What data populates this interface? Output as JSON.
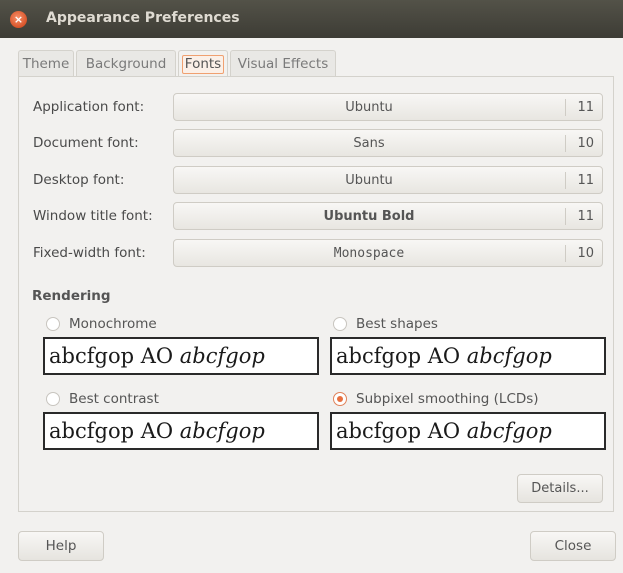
{
  "window": {
    "title": "Appearance Preferences"
  },
  "tabs": [
    {
      "label": "Theme"
    },
    {
      "label": "Background"
    },
    {
      "label": "Fonts"
    },
    {
      "label": "Visual Effects"
    }
  ],
  "active_tab": "Fonts",
  "fonts": [
    {
      "label": "Application font:",
      "name": "Ubuntu",
      "size": "11"
    },
    {
      "label": "Document font:",
      "name": "Sans",
      "size": "10"
    },
    {
      "label": "Desktop font:",
      "name": "Ubuntu",
      "size": "11"
    },
    {
      "label": "Window title font:",
      "name": "Ubuntu Bold",
      "size": "11"
    },
    {
      "label": "Fixed-width font:",
      "name": "Monospace",
      "size": "10"
    }
  ],
  "rendering": {
    "heading": "Rendering",
    "options": [
      {
        "label": "Monochrome",
        "selected": false
      },
      {
        "label": "Best shapes",
        "selected": false
      },
      {
        "label": "Best contrast",
        "selected": false
      },
      {
        "label": "Subpixel smoothing (LCDs)",
        "selected": true
      }
    ],
    "sample_regular": "abcfgop AO ",
    "sample_italic": "abcfgop"
  },
  "buttons": {
    "details": "Details...",
    "help": "Help",
    "close": "Close"
  },
  "colors": {
    "accent": "#e8703f",
    "titlebar": "#3d3c35"
  }
}
